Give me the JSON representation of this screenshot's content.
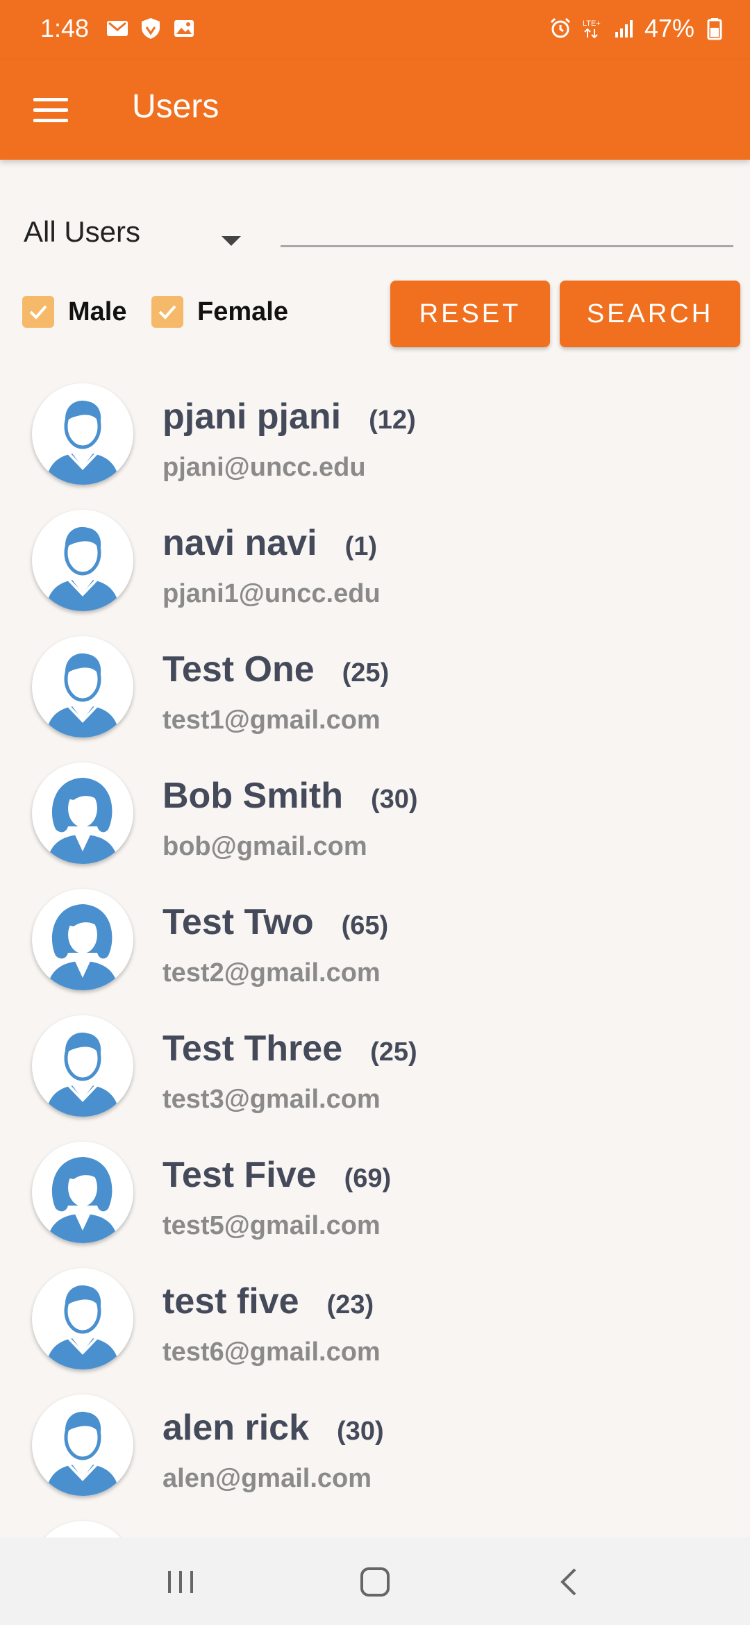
{
  "status_bar": {
    "time": "1:48",
    "battery": "47%",
    "left_icons": [
      "gmail-icon",
      "shield-icon",
      "image-icon"
    ],
    "right_icons": [
      "alarm-icon",
      "lte-icon",
      "signal-icon",
      "battery-icon"
    ]
  },
  "app_bar": {
    "title": "Users",
    "menu_icon": "hamburger-menu-icon"
  },
  "filter": {
    "dropdown_value": "All Users",
    "search_placeholder": "",
    "search_value": ""
  },
  "controls": {
    "male_label": "Male",
    "male_checked": true,
    "female_label": "Female",
    "female_checked": true,
    "reset_label": "RESET",
    "search_label": "SEARCH"
  },
  "users": [
    {
      "name": "pjani pjani",
      "age": "(12)",
      "email": "pjani@uncc.edu",
      "gender": "male"
    },
    {
      "name": "navi navi",
      "age": "(1)",
      "email": "pjani1@uncc.edu",
      "gender": "male"
    },
    {
      "name": "Test One",
      "age": "(25)",
      "email": "test1@gmail.com",
      "gender": "male"
    },
    {
      "name": "Bob Smith",
      "age": "(30)",
      "email": "bob@gmail.com",
      "gender": "female"
    },
    {
      "name": "Test Two",
      "age": "(65)",
      "email": "test2@gmail.com",
      "gender": "female"
    },
    {
      "name": "Test Three",
      "age": "(25)",
      "email": "test3@gmail.com",
      "gender": "male"
    },
    {
      "name": "Test Five",
      "age": "(69)",
      "email": "test5@gmail.com",
      "gender": "female"
    },
    {
      "name": "test five",
      "age": "(23)",
      "email": "test6@gmail.com",
      "gender": "male"
    },
    {
      "name": "alen rick",
      "age": "(30)",
      "email": "alen@gmail.com",
      "gender": "male"
    },
    {
      "name": "",
      "age": "",
      "email": "",
      "gender": "male"
    }
  ],
  "nav": {
    "icons": [
      "recent-apps-icon",
      "home-icon",
      "back-icon"
    ]
  },
  "colors": {
    "primary": "#f1701f",
    "checkbox": "#f6b96a",
    "avatar_blue": "#4a90cf",
    "background": "#f8f5f2"
  }
}
